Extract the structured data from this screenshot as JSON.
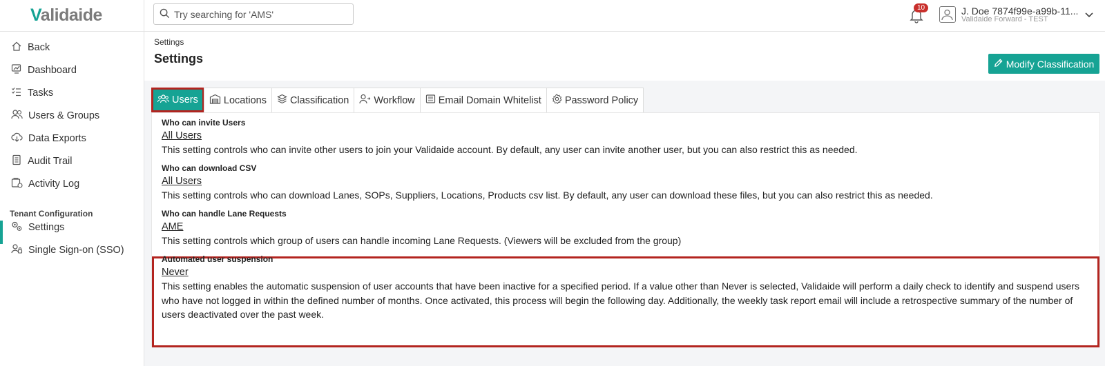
{
  "header": {
    "logo_v": "V",
    "logo_rest": "alidaide",
    "search_placeholder": "Try searching for 'AMS'",
    "notification_count": "10",
    "user_name": "J. Doe 7874f99e-a99b-11...",
    "user_org": "Validaide Forward - TEST"
  },
  "sidebar": {
    "items": [
      {
        "label": "Back",
        "icon": "home-icon"
      },
      {
        "label": "Dashboard",
        "icon": "dashboard-icon"
      },
      {
        "label": "Tasks",
        "icon": "tasks-icon"
      },
      {
        "label": "Users & Groups",
        "icon": "users-icon"
      },
      {
        "label": "Data Exports",
        "icon": "cloud-download-icon"
      },
      {
        "label": "Audit Trail",
        "icon": "audit-icon"
      },
      {
        "label": "Activity Log",
        "icon": "activity-icon"
      }
    ],
    "section_title": "Tenant Configuration",
    "config_items": [
      {
        "label": "Settings",
        "icon": "settings-icon"
      },
      {
        "label": "Single Sign-on (SSO)",
        "icon": "sso-icon"
      }
    ]
  },
  "main": {
    "breadcrumb": "Settings",
    "title": "Settings",
    "modify_label": "Modify Classification",
    "tabs": [
      {
        "label": "Users",
        "icon": "users-icon"
      },
      {
        "label": "Locations",
        "icon": "building-icon"
      },
      {
        "label": "Classification",
        "icon": "layers-icon"
      },
      {
        "label": "Workflow",
        "icon": "user-flow-icon"
      },
      {
        "label": "Email Domain Whitelist",
        "icon": "list-icon"
      },
      {
        "label": "Password Policy",
        "icon": "gear-icon"
      }
    ],
    "settings": [
      {
        "title": "Who can invite Users",
        "value": "All Users",
        "description": "This setting controls who can invite other users to join your Validaide account. By default, any user can invite another user, but you can also restrict this as needed."
      },
      {
        "title": "Who can download CSV",
        "value": "All Users",
        "description": "This setting controls who can download Lanes, SOPs, Suppliers, Locations, Products csv list. By default, any user can download these files, but you can also restrict this as needed."
      },
      {
        "title": "Who can handle Lane Requests",
        "value": "AME",
        "description": "This setting controls which group of users can handle incoming Lane Requests. (Viewers will be excluded from the group)"
      },
      {
        "title": "Automated user suspension",
        "value": "Never",
        "description": "This setting enables the automatic suspension of user accounts that have been inactive for a specified period. If a value other than Never is selected, Validaide will perform a daily check to identify and suspend users who have not logged in within the defined number of months. Once activated, this process will begin the following day. Additionally, the weekly task report email will include a retrospective summary of the number of users deactivated over the past week."
      }
    ]
  },
  "colors": {
    "accent": "#16a394",
    "highlight": "#b3241f",
    "badge": "#c9302c"
  }
}
